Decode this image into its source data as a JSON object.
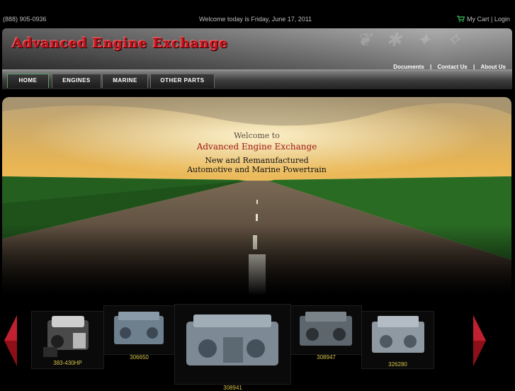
{
  "topbar": {
    "phone": "(888) 905-0936",
    "welcome": "Welcome today is Friday, June 17, 2011",
    "cart_label": "My Cart",
    "separator": "|",
    "login_label": "Login"
  },
  "header": {
    "logo_text": "Advanced Engine Exchange",
    "links": [
      "Documents",
      "Contact Us",
      "About Us"
    ],
    "link_separator": "|"
  },
  "nav": {
    "items": [
      "HOME",
      "ENGINES",
      "MARINE",
      "OTHER PARTS"
    ]
  },
  "hero": {
    "line1": "Welcome to",
    "line2": "Advanced Engine Exchange",
    "line3": "New and Remanufactured",
    "line4": "Automotive and Marine Powertrain"
  },
  "carousel": {
    "items": [
      {
        "label": "383-430HP"
      },
      {
        "label": "306650"
      },
      {
        "label": "308941"
      },
      {
        "label": "308947"
      },
      {
        "label": "326280"
      }
    ]
  },
  "colors": {
    "accent_red": "#c8141e",
    "label_gold": "#d6c24a",
    "cart_green": "#2fa84f"
  },
  "icons": {
    "cart": "shopping-cart-icon",
    "prev": "chevron-left-icon",
    "next": "chevron-right-icon"
  }
}
